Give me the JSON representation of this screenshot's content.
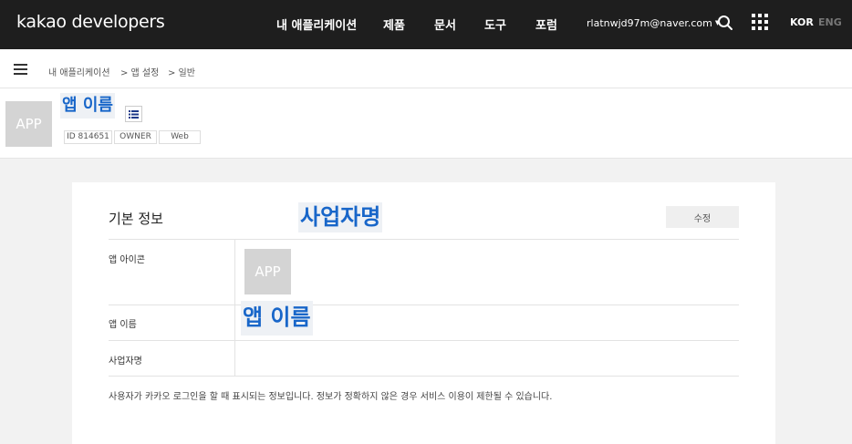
{
  "header": {
    "logo": "kakao developers",
    "nav": [
      "내 애플리케이션",
      "제품",
      "문서",
      "도구",
      "포럼"
    ],
    "account": "rlatnwjd97m@naver.com",
    "lang_kor": "KOR",
    "lang_eng": "ENG"
  },
  "breadcrumb": [
    "내 애플리케이션",
    "> 앱 설정",
    "> 일반"
  ],
  "app": {
    "thumb_text": "APP",
    "name": "앱 이름",
    "tags": [
      "ID 814651",
      "OWNER",
      "Web"
    ]
  },
  "card": {
    "title": "기본 정보",
    "company_overlay": "사업자명",
    "edit_label": "수정",
    "rows": [
      "앱 아이콘",
      "앱 이름",
      "사업자명"
    ],
    "icon_thumb_text": "APP",
    "app_name_overlay": "앱 이름",
    "notice": "사용자가 카카오 로그인을 할 때 표시되는 정보입니다. 정보가 정확하지 않은 경우 서비스 이용이 제한될 수 있습니다."
  },
  "colors": {
    "topbar": "#1e1e1e",
    "highlight": "#1866c9",
    "page_bg": "#f2f2f2"
  }
}
